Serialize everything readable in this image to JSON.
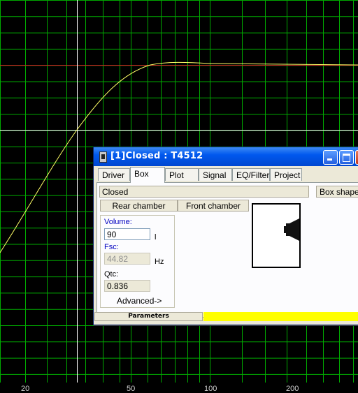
{
  "plot": {
    "x_axis_labels": [
      "20",
      "50",
      "100",
      "200"
    ],
    "colors": {
      "background": "#000000",
      "grid": "#00aa00",
      "curve": "#ffff66",
      "reference_line": "#cc2222",
      "cursor": "#ffffff"
    }
  },
  "window": {
    "title": "[1]Closed : T4512",
    "tabs": [
      {
        "label": "Driver"
      },
      {
        "label": "Box"
      },
      {
        "label": "Plot"
      },
      {
        "label": "Signal"
      },
      {
        "label": "EQ/Filter"
      },
      {
        "label": "Project"
      }
    ],
    "active_tab": "Box",
    "box_type": "Closed",
    "box_shape_label": "Box shape",
    "rear_chamber_label": "Rear chamber",
    "front_chamber_label": "Front chamber",
    "volume_label": "Volume:",
    "volume_value": "90",
    "volume_unit": "l",
    "fsc_label": "Fsc:",
    "fsc_value": "44.82",
    "fsc_unit": "Hz",
    "qtc_label": "Qtc:",
    "qtc_value": "0.836",
    "advanced_label": "Advanced->",
    "status_label": "Parameters",
    "status_color": "#ffff00"
  }
}
